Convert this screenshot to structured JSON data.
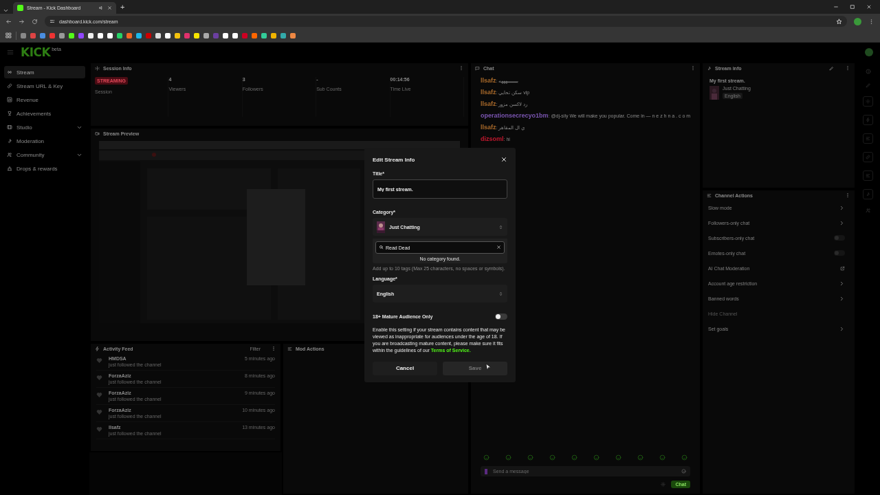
{
  "browser": {
    "tabs": [
      {
        "title": "Stream - Kick Dashboard",
        "selected": true
      }
    ],
    "new_tab": "+",
    "url": "dashboard.kick.com/stream"
  },
  "header": {
    "logo": "KICK",
    "badge": "beta"
  },
  "sidebar": {
    "items": [
      {
        "label": "Stream",
        "selected": true,
        "expandable": false
      },
      {
        "label": "Stream URL & Key",
        "selected": false,
        "expandable": false
      },
      {
        "label": "Revenue",
        "selected": false,
        "expandable": false
      },
      {
        "label": "Achievements",
        "selected": false,
        "expandable": false
      },
      {
        "label": "Studio",
        "selected": false,
        "expandable": true
      },
      {
        "label": "Moderation",
        "selected": false,
        "expandable": false
      },
      {
        "label": "Community",
        "selected": false,
        "expandable": true
      },
      {
        "label": "Drops & rewards",
        "selected": false,
        "expandable": false
      }
    ]
  },
  "session_info": {
    "title": "Session Info",
    "stats": [
      {
        "kind": "badge",
        "value": "STREAMING",
        "label": "Session"
      },
      {
        "kind": "number",
        "value": "4",
        "label": "Viewers"
      },
      {
        "kind": "number",
        "value": "3",
        "label": "Followers"
      },
      {
        "kind": "number",
        "value": "-",
        "label": "Sub Counts"
      },
      {
        "kind": "number",
        "value": "00:14:56",
        "label": "Time Live"
      }
    ]
  },
  "stream_preview": {
    "title": "Stream Preview"
  },
  "activity_feed": {
    "title": "Activity Feed",
    "filter": "Filter",
    "events": [
      {
        "user": "HMDSA",
        "action": "just followed the channel",
        "time": "5 minutes ago"
      },
      {
        "user": "ForzaAziz",
        "action": "just followed the channel",
        "time": "8 minutes ago"
      },
      {
        "user": "ForzaAziz",
        "action": "just followed the channel",
        "time": "9 minutes ago"
      },
      {
        "user": "ForzaAziz",
        "action": "just followed the channel",
        "time": "10 minutes ago"
      },
      {
        "user": "llsafz",
        "action": "just followed the channel",
        "time": "13 minutes ago"
      }
    ]
  },
  "mod_actions": {
    "title": "Mod Actions"
  },
  "chat": {
    "title": "Chat",
    "messages": [
      {
        "user": "llsafz",
        "color": "#a8692a",
        "text": ": ببببببببهههه"
      },
      {
        "user": "llsafz",
        "color": "#a8692a",
        "text": ": سكن تحايي vip"
      },
      {
        "user": "llsafz",
        "color": "#a8692a",
        "text": ": رد لاكسن مزور"
      },
      {
        "user": "operationsecrecyo1bm",
        "color": "#7a55b0",
        "text": ": @dj-sily We will make you popular. Come in — n e z h n a . c o m"
      },
      {
        "user": "llsafz",
        "color": "#a8692a",
        "text": ": ي ال المقاهر"
      },
      {
        "user": "dizsoml",
        "color": "#c0182e",
        "text": ": hi"
      }
    ],
    "input": {
      "placeholder": "Send a message"
    },
    "send": "Chat"
  },
  "stream_info": {
    "title": "Stream info",
    "stream_title": "My first stream.",
    "category": "Just Chatting",
    "language": "English"
  },
  "channel_actions": {
    "title": "Channel Actions",
    "items": [
      {
        "label": "Slow mode",
        "kind": "link",
        "disabled": false
      },
      {
        "label": "Followers-only chat",
        "kind": "link",
        "disabled": false
      },
      {
        "label": "Subscribers-only chat",
        "kind": "toggle",
        "on": false,
        "disabled": false
      },
      {
        "label": "Emotes-only chat",
        "kind": "toggle",
        "on": false,
        "disabled": false
      },
      {
        "label": "AI Chat Moderation",
        "kind": "external",
        "disabled": false
      },
      {
        "label": "Account age restriction",
        "kind": "link",
        "disabled": false
      },
      {
        "label": "Banned words",
        "kind": "link",
        "disabled": false
      },
      {
        "label": "Hide Channel",
        "kind": "plain",
        "disabled": true
      },
      {
        "label": "Set goals",
        "kind": "link",
        "disabled": false
      }
    ]
  },
  "modal": {
    "title": "Edit Stream Info",
    "title_label": "Title*",
    "title_value": "My first stream.",
    "category_label": "Category*",
    "category_value": "Just Chatting",
    "category_search": "Read Dead",
    "no_results": "No category found.",
    "tags_hint": "Add up to 10 tags (Max 25 characters, no spaces or symbols).",
    "language_label": "Language*",
    "language_value": "English",
    "mature": {
      "label": "18+ Mature Audience Only",
      "on": false
    },
    "mature_note": "Enable this setting if your stream contains content that may be viewed as inappropriate for audiences under the age of 18. If you are broadcasting mature content, please make sure it fits within the guidelines of our ",
    "terms_link": "Terms of Service.",
    "buttons": [
      {
        "label": "Cancel",
        "disabled": false
      },
      {
        "label": "Save",
        "disabled": true
      }
    ]
  }
}
